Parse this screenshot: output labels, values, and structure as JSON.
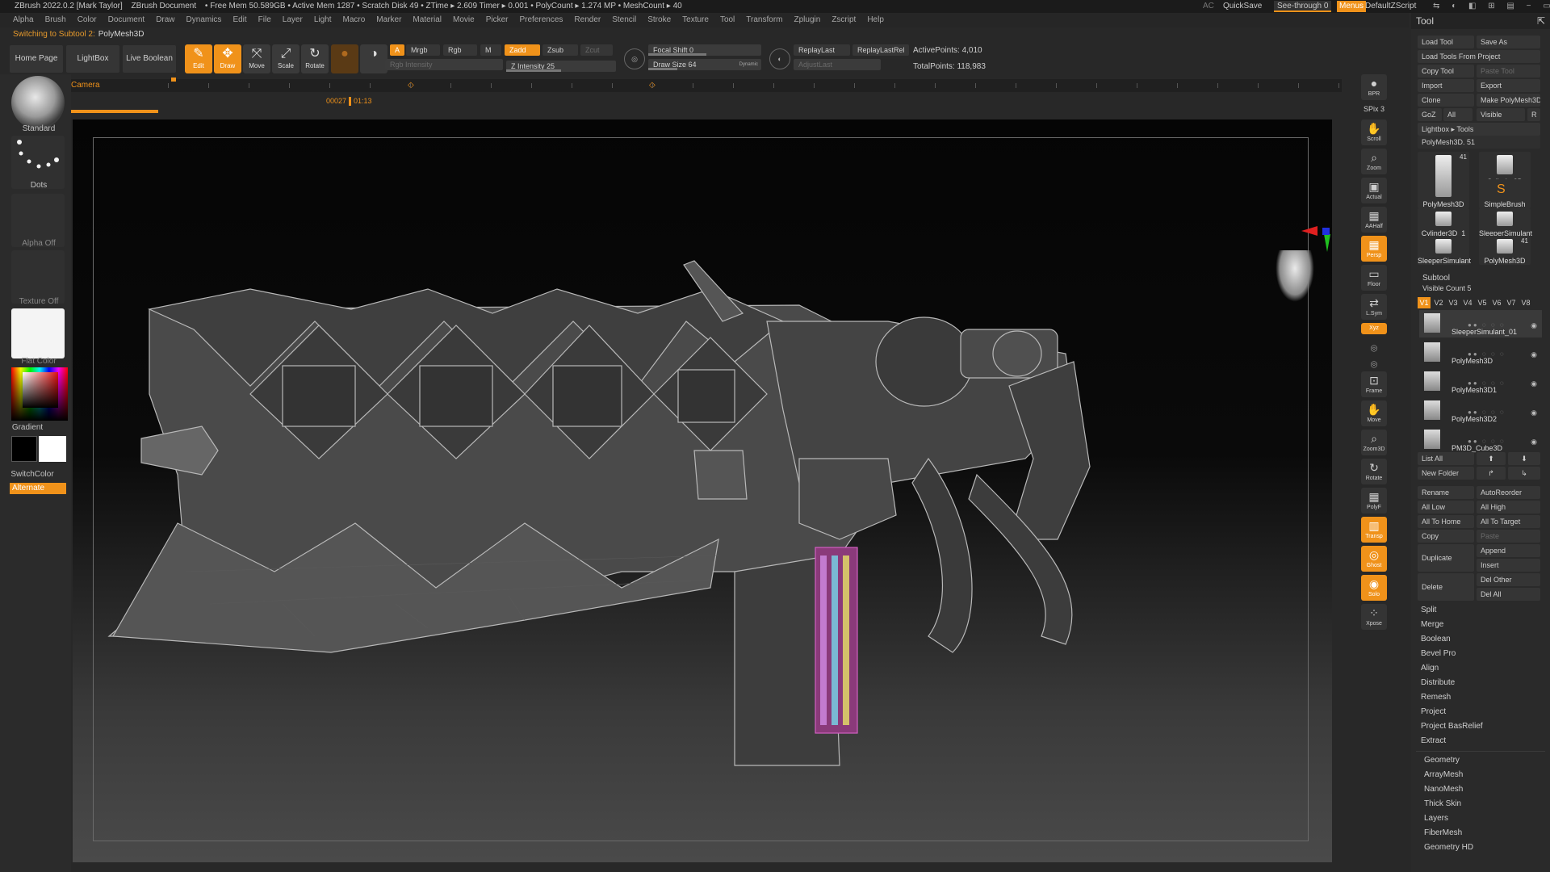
{
  "titlebar": {
    "app": "ZBrush 2022.0.2 [Mark Taylor]",
    "doc": "ZBrush Document",
    "stats": "• Free Mem 50.589GB • Active Mem 1287 • Scratch Disk 49 • ZTime ▸ 2.609 Timer ▸ 0.001 • PolyCount ▸ 1.274 MP • MeshCount ▸ 40",
    "ac": "AC",
    "quicksave": "QuickSave",
    "seethrough": "See-through  0",
    "menus": "Menus",
    "script": "DefaultZScript"
  },
  "menubar": [
    "Alpha",
    "Brush",
    "Color",
    "Document",
    "Draw",
    "Dynamics",
    "Edit",
    "File",
    "Layer",
    "Light",
    "Macro",
    "Marker",
    "Material",
    "Movie",
    "Picker",
    "Preferences",
    "Render",
    "Stencil",
    "Stroke",
    "Texture",
    "Tool",
    "Transform",
    "Zplugin",
    "Zscript",
    "Help"
  ],
  "notice": {
    "label": "Switching to Subtool 2:",
    "value": "PolyMesh3D"
  },
  "shelf": {
    "home": "Home Page",
    "lightbox": "LightBox",
    "liveboolean": "Live Boolean"
  },
  "tools": {
    "edit": "Edit",
    "draw": "Draw",
    "move": "Move",
    "scale": "Scale",
    "rotate": "Rotate"
  },
  "draw": {
    "a": "A",
    "mrgb": "Mrgb",
    "rgb": "Rgb",
    "m": "M",
    "zadd": "Zadd",
    "zsub": "Zsub",
    "zcut": "Zcut",
    "rgb_intensity": "Rgb Intensity",
    "z_intensity": "Z Intensity 25",
    "focal_shift": "Focal Shift 0",
    "draw_size": "Draw Size 64",
    "dynamic": "Dynamic",
    "replay_last": "ReplayLast",
    "replay_last_rel": "ReplayLastRel",
    "adjust_last": "AdjustLast",
    "active_points": "ActivePoints: 4,010",
    "total_points": "TotalPoints: 118,983"
  },
  "timeline": {
    "label": "Camera",
    "frame": "00027",
    "time": "01:13"
  },
  "left": {
    "brush": "Standard",
    "stroke": "Dots",
    "alpha": "Alpha Off",
    "texture": "Texture Off",
    "material": "Flat Color",
    "gradient": "Gradient",
    "switch": "SwitchColor",
    "alternate": "Alternate"
  },
  "rightstrip": [
    "BPR",
    "SPix 3",
    "Scroll",
    "Zoom",
    "Actual",
    "AAHalf",
    "Persp",
    "Floor",
    "L.Sym",
    "Xyz",
    "",
    "",
    "Frame",
    "Move",
    "Zoom3D",
    "Rotate",
    "PolyF",
    "Transp",
    "Ghost",
    "Solo",
    "Xpose"
  ],
  "tray": {
    "title": "Tool",
    "buttons": [
      [
        "Load Tool",
        "Save As"
      ],
      [
        "Load Tools From Project",
        ""
      ],
      [
        "Copy Tool",
        "Paste Tool"
      ],
      [
        "Import",
        "Export"
      ],
      [
        "Clone",
        "Make PolyMesh3D"
      ]
    ],
    "goz": "GoZ",
    "all": "All",
    "visible": "Visible",
    "r": "R",
    "lightbox_tools": "Lightbox ▸ Tools",
    "polymesh_slider": "PolyMesh3D. 51",
    "thumbs": [
      "PolyMesh3D",
      "Cylinder3D",
      "SimpleBrush",
      "Cylinder3D_1",
      "SleeperSimulant",
      "SleeperSimulant",
      "PolyMesh3D"
    ],
    "thumb_count1": "41",
    "thumb_count2": "41",
    "subtool": "Subtool",
    "visible_count": "Visible Count 5",
    "vtabs": [
      "V1",
      "V2",
      "V3",
      "V4",
      "V5",
      "V6",
      "V7",
      "V8"
    ],
    "subtools": [
      "SleeperSimulant_01",
      "PolyMesh3D",
      "PolyMesh3D1",
      "PolyMesh3D2",
      "PM3D_Cube3D"
    ],
    "listall": "List All",
    "newfolder": "New Folder",
    "actions": [
      [
        "Rename",
        "AutoReorder"
      ],
      [
        "All Low",
        "All High"
      ],
      [
        "All To Home",
        "All To Target"
      ],
      [
        "Copy",
        "Paste"
      ]
    ],
    "duplicate": "Duplicate",
    "append": "Append",
    "insert": "Insert",
    "delete": "Delete",
    "delother": "Del Other",
    "delall": "Del All",
    "menu": [
      "Split",
      "Merge",
      "Boolean",
      "Bevel Pro",
      "Align",
      "Distribute",
      "Remesh",
      "Project",
      "Project BasRelief",
      "Extract"
    ],
    "sections": [
      "Geometry",
      "ArrayMesh",
      "NanoMesh",
      "Thick Skin",
      "Layers",
      "FiberMesh",
      "Geometry HD"
    ]
  }
}
